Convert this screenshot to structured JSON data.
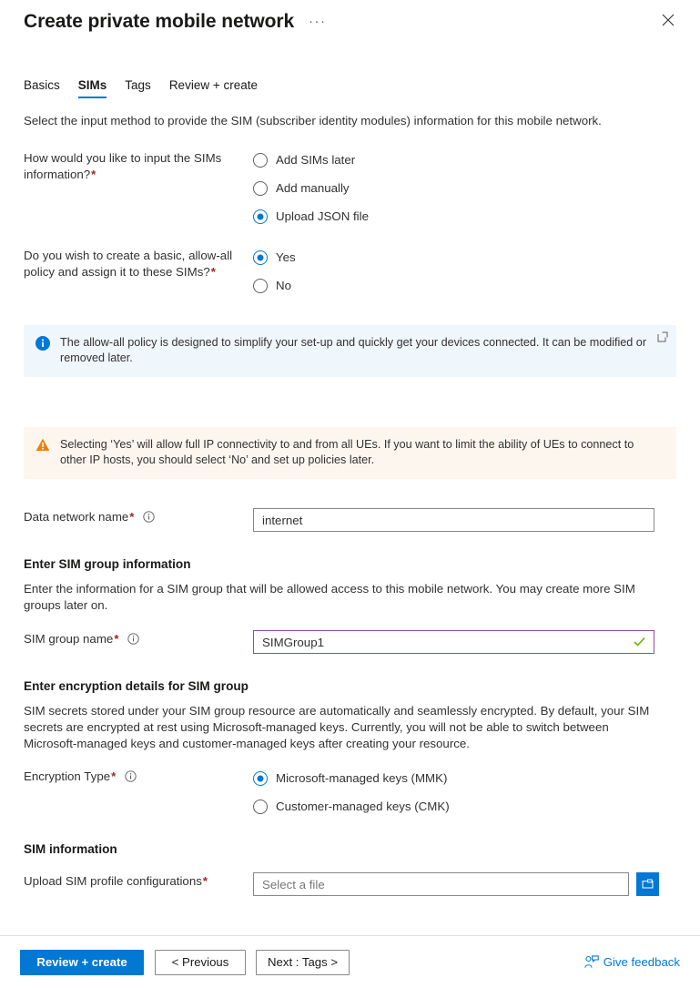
{
  "header": {
    "title": "Create private mobile network",
    "more_label": "···",
    "close_label": "Close"
  },
  "tabs": [
    {
      "label": "Basics",
      "active": false
    },
    {
      "label": "SIMs",
      "active": true
    },
    {
      "label": "Tags",
      "active": false
    },
    {
      "label": "Review + create",
      "active": false
    }
  ],
  "intro": "Select the input method to provide the SIM (subscriber identity modules) information for this mobile network.",
  "input_method": {
    "label": "How would you like to input the SIMs information?",
    "required": "*",
    "options": [
      {
        "label": "Add SIMs later",
        "selected": false
      },
      {
        "label": "Add manually",
        "selected": false
      },
      {
        "label": "Upload JSON file",
        "selected": true
      }
    ]
  },
  "allow_all_policy": {
    "label": "Do you wish to create a basic, allow-all policy and assign it to these SIMs?",
    "required": "*",
    "options": [
      {
        "label": "Yes",
        "selected": true
      },
      {
        "label": "No",
        "selected": false
      }
    ]
  },
  "info_banner": {
    "icon": "info-circle-icon",
    "text": "The allow-all policy is designed to simplify your set-up and quickly get your devices connected. It can be modified or removed later.",
    "link_icon": "external-link-icon",
    "background": "#eff6fc"
  },
  "warning_banner": {
    "icon": "warning-triangle-icon",
    "text": "Selecting ‘Yes’ will allow full IP connectivity to and from all UEs. If you want to limit the ability of UEs to connect to other IP hosts, you should select ‘No’ and set up policies later.",
    "background": "#fdf6ef"
  },
  "data_network_name": {
    "label": "Data network name",
    "required": "*",
    "info_icon": "info-icon",
    "value": "internet",
    "placeholder": ""
  },
  "sim_group_section": {
    "heading": "Enter SIM group information",
    "description": "Enter the information for a SIM group that will be allowed access to this mobile network. You may create more SIM groups later on.",
    "field_label": "SIM group name",
    "required": "*",
    "info_icon": "info-icon",
    "value": "SIMGroup1",
    "validation_icon": "checkmark-icon",
    "border_color": "#8f4f9e",
    "check_color": "#6bb700"
  },
  "encryption_section": {
    "heading": "Enter encryption details for SIM group",
    "description": "SIM secrets stored under your SIM group resource are automatically and seamlessly encrypted. By default, your SIM secrets are encrypted at rest using Microsoft-managed keys. Currently, you will not be able to switch between Microsoft-managed keys and customer-managed keys after creating your resource.",
    "field_label": "Encryption Type",
    "required": "*",
    "info_icon": "info-icon",
    "options": [
      {
        "label": "Microsoft-managed keys (MMK)",
        "selected": true
      },
      {
        "label": "Customer-managed keys (CMK)",
        "selected": false
      }
    ]
  },
  "sim_information": {
    "heading": "SIM information",
    "field_label": "Upload SIM profile configurations",
    "required": "*",
    "value": "",
    "placeholder": "Select a file",
    "browse_icon": "folder-open-icon"
  },
  "footer": {
    "review_create": "Review + create",
    "previous": "< Previous",
    "next": "Next : Tags >",
    "feedback": "Give feedback",
    "feedback_icon": "feedback-person-icon"
  },
  "colors": {
    "accent": "#0078d4",
    "required_red": "#a4262c",
    "warning_orange": "#d67100",
    "info_blue": "#0078d4"
  }
}
